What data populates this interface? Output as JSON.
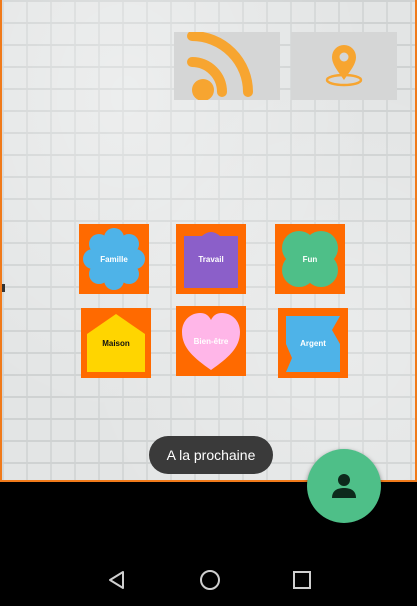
{
  "top_actions": {
    "rss": {
      "icon": "rss-icon",
      "color": "#f7a530"
    },
    "location": {
      "icon": "location-pin-icon",
      "color": "#f7a530"
    }
  },
  "categories": [
    {
      "label": "Famille",
      "shape": "flower",
      "shape_color": "#4eb3e8",
      "text_color": "#ffffff"
    },
    {
      "label": "Travail",
      "shape": "square-tab",
      "shape_color": "#8b5fc9",
      "text_color": "#ffffff"
    },
    {
      "label": "Fun",
      "shape": "clover",
      "shape_color": "#4ebf88",
      "text_color": "#ffffff"
    },
    {
      "label": "Maison",
      "shape": "house",
      "shape_color": "#ffd500",
      "text_color": "#111111"
    },
    {
      "label": "Bien-être",
      "shape": "heart",
      "shape_color": "#ffb6e8",
      "text_color": "#ffffff"
    },
    {
      "label": "Argent",
      "shape": "banner",
      "shape_color": "#4eb3e8",
      "text_color": "#ffffff"
    }
  ],
  "toast": {
    "text": "A la prochaine"
  },
  "fab": {
    "icon": "person-icon",
    "color": "#4ebf88"
  },
  "navbar": {
    "back": {
      "icon": "back-triangle-icon"
    },
    "home": {
      "icon": "home-circle-icon"
    },
    "recent": {
      "icon": "recent-square-icon"
    }
  },
  "colors": {
    "accent": "#ff6a00",
    "border": "#f07a1a"
  }
}
